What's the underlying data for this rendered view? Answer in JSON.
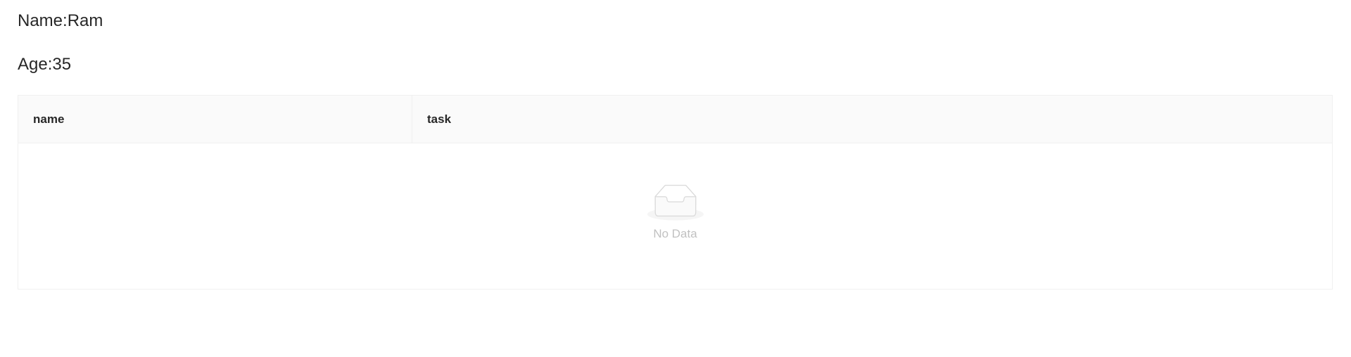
{
  "profile": {
    "name_line": "Name:Ram",
    "age_line": "Age:35"
  },
  "table": {
    "columns": [
      "name",
      "task"
    ],
    "rows": [],
    "empty_text": "No Data"
  },
  "icons": {
    "empty": "empty-inbox-icon"
  }
}
